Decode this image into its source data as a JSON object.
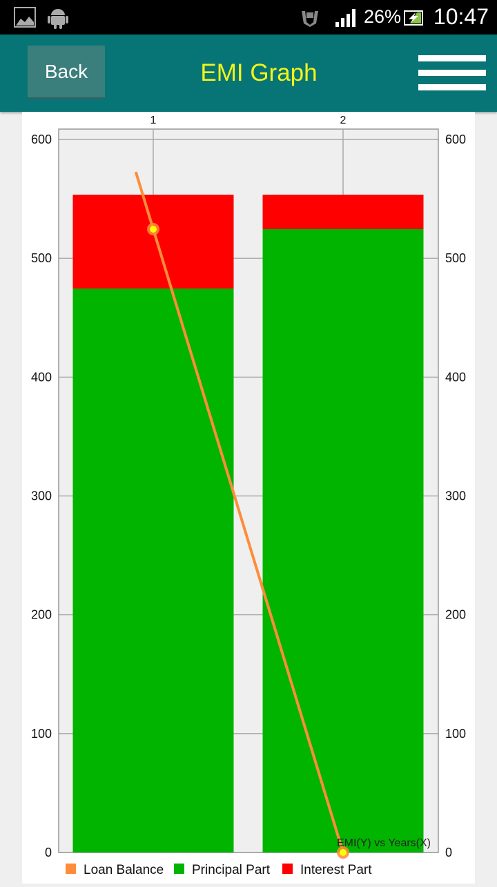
{
  "status_bar": {
    "icons": [
      "gallery-icon",
      "android-icon",
      "vpn-icon",
      "signal-icon",
      "battery-charging-icon"
    ],
    "battery": "26%",
    "time": "10:47"
  },
  "app_bar": {
    "back_label": "Back",
    "title": "EMI Graph",
    "menu_icon": "hamburger-menu-icon"
  },
  "colors": {
    "loan_balance": "#ff8c3a",
    "principal": "#00b400",
    "interest": "#ff0000",
    "appbar": "#077575",
    "title": "#f4f41a"
  },
  "chart_data": {
    "type": "bar",
    "stacked": true,
    "categories": [
      "1",
      "2"
    ],
    "series": [
      {
        "name": "Principal Part",
        "type": "bar",
        "values": [
          474.5,
          524.5
        ]
      },
      {
        "name": "Interest Part",
        "type": "bar",
        "values": [
          79,
          29
        ]
      },
      {
        "name": "Loan Balance",
        "type": "line",
        "values": [
          524.5,
          0
        ]
      }
    ],
    "ylim": [
      0,
      600
    ],
    "yticks": [
      "0",
      "100",
      "200",
      "300",
      "400",
      "500",
      "600"
    ],
    "annotation": "EMI(Y) vs Years(X)",
    "legend_position": "bottom-left",
    "grid": true
  }
}
